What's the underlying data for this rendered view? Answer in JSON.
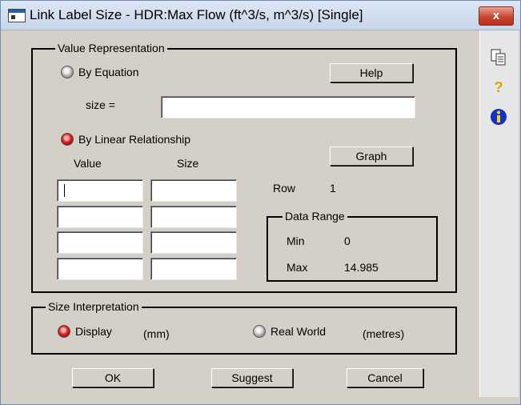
{
  "window": {
    "title": "Link Label Size - HDR:Max Flow (ft^3/s, m^3/s) [Single]",
    "close_label": "x"
  },
  "value_representation": {
    "legend": "Value Representation",
    "by_equation_label": "By Equation",
    "by_equation_selected": false,
    "help_label": "Help",
    "size_label": "size =",
    "size_value": "",
    "by_linear_label": "By Linear Relationship",
    "by_linear_selected": true,
    "graph_label": "Graph",
    "value_header": "Value",
    "size_header": "Size",
    "rows": [
      {
        "value": "",
        "size": ""
      },
      {
        "value": "",
        "size": ""
      },
      {
        "value": "",
        "size": ""
      },
      {
        "value": "",
        "size": ""
      }
    ],
    "row_label": "Row",
    "row_value": "1",
    "data_range": {
      "legend": "Data Range",
      "min_label": "Min",
      "min_value": "0",
      "max_label": "Max",
      "max_value": "14.985"
    }
  },
  "size_interpretation": {
    "legend": "Size Interpretation",
    "display_label": "Display",
    "display_selected": true,
    "display_unit": "(mm)",
    "real_world_label": "Real World",
    "real_world_selected": false,
    "real_world_unit": "(metres)"
  },
  "buttons": {
    "ok": "OK",
    "suggest": "Suggest",
    "cancel": "Cancel"
  },
  "sidebar": {
    "icons": [
      "copy-icon",
      "help-icon",
      "info-icon"
    ]
  }
}
